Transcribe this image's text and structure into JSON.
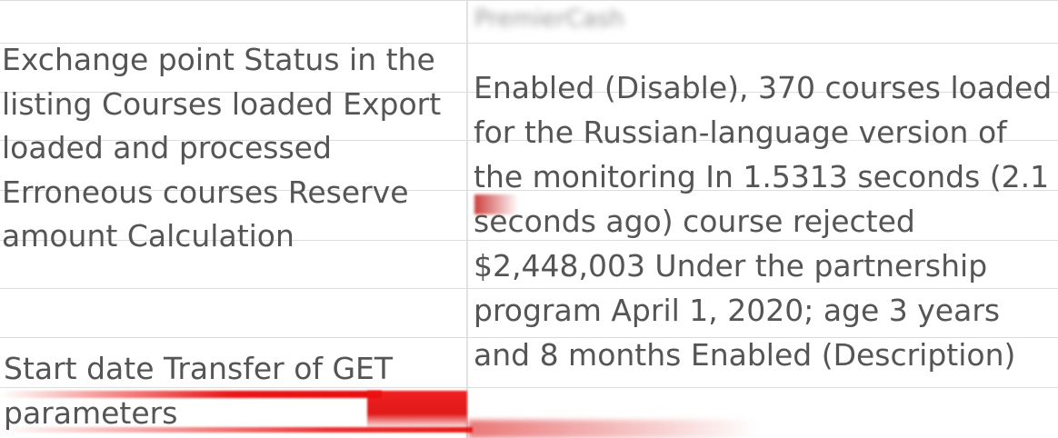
{
  "header": {
    "blurred_label": "PremierCash"
  },
  "rows": {
    "left_block_1": "Exchange point Status in the listing Courses loaded Export loaded and processed Erroneous courses Reserve amount Calculation",
    "left_block_2": "Start date Transfer of GET parameters",
    "right_block": "Enabled (Disable), 370 courses loaded for the Russian-language version of the monitoring In 1.5313 seconds (2.1 seconds ago) course rejected $2,448,003 Under the partnership program April 1, 2020; age 3 years and 8 months Enabled (Description)"
  },
  "colors": {
    "text": "#555555",
    "grid_line": "#dcdcdc",
    "redaction": "#e00000"
  }
}
